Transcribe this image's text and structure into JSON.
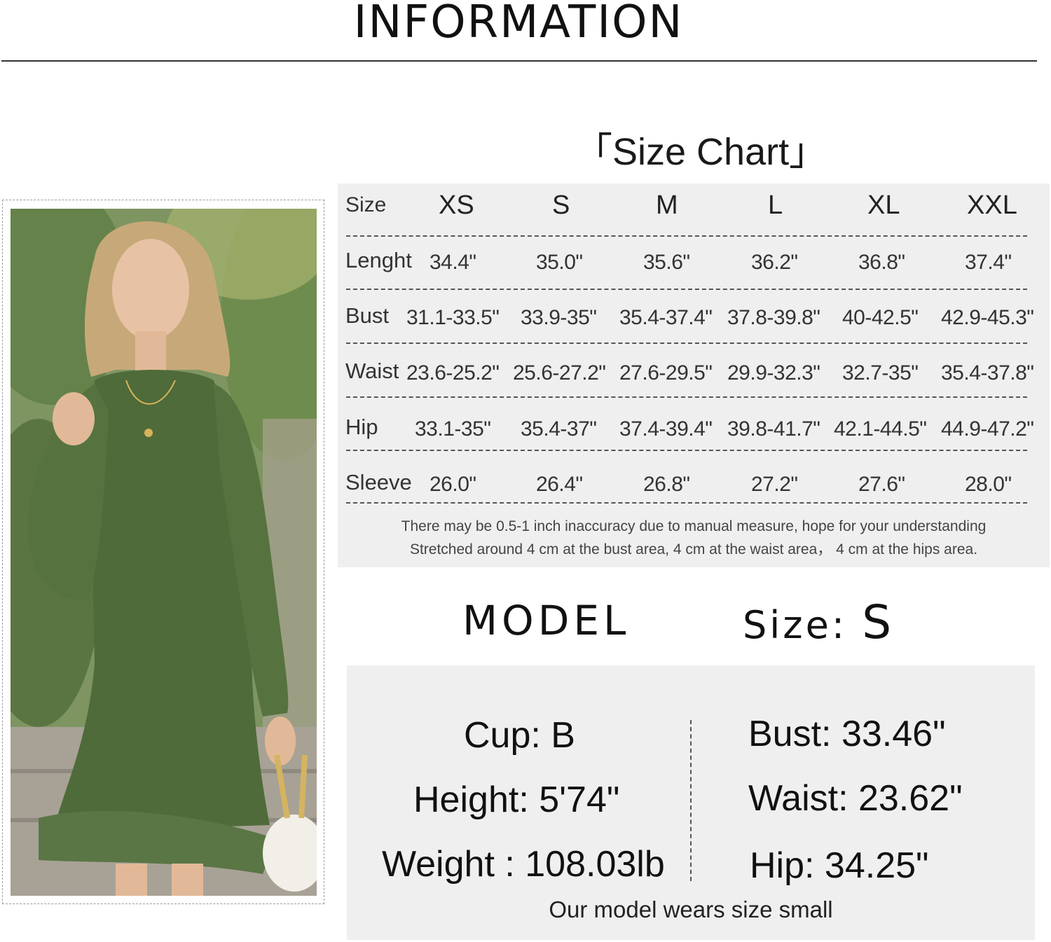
{
  "header": {
    "title": "INFORMATION"
  },
  "size_chart": {
    "title": "「Size Chart」",
    "row_header": "Size",
    "sizes": [
      "XS",
      "S",
      "M",
      "L",
      "XL",
      "XXL"
    ],
    "rows": [
      {
        "label": "Lenght",
        "values": [
          "34.4\"",
          "35.0\"",
          "35.6\"",
          "36.2\"",
          "36.8\"",
          "37.4\""
        ]
      },
      {
        "label": "Bust",
        "values": [
          "31.1-33.5\"",
          "33.9-35\"",
          "35.4-37.4\"",
          "37.8-39.8\"",
          "40-42.5\"",
          "42.9-45.3\""
        ]
      },
      {
        "label": "Waist",
        "values": [
          "23.6-25.2\"",
          "25.6-27.2\"",
          "27.6-29.5\"",
          "29.9-32.3\"",
          "32.7-35\"",
          "35.4-37.8\""
        ]
      },
      {
        "label": "Hip",
        "values": [
          "33.1-35\"",
          "35.4-37\"",
          "37.4-39.4\"",
          "39.8-41.7\"",
          "42.1-44.5\"",
          "44.9-47.2\""
        ]
      },
      {
        "label": "Sleeve",
        "values": [
          "26.0\"",
          "26.4\"",
          "26.8\"",
          "27.2\"",
          "27.6\"",
          "28.0\""
        ]
      }
    ],
    "note_line1": "There may be 0.5-1 inch inaccuracy due to manual measure, hope for your understanding",
    "note_line2": "Stretched around 4 cm at the bust area, 4 cm at the waist area， 4 cm at the hips area."
  },
  "model": {
    "title": "MODEL",
    "size_label": "Size:",
    "size_value": "S",
    "left_stats": [
      "Cup: B",
      "Height: 5'74\"",
      "Weight : 108.03lb"
    ],
    "right_stats": [
      "Bust: 33.46\"",
      "Waist: 23.62\"",
      "Hip: 34.25\""
    ],
    "note": "Our model wears size small"
  },
  "photo": {
    "dress_color": "#4f6b3a"
  }
}
